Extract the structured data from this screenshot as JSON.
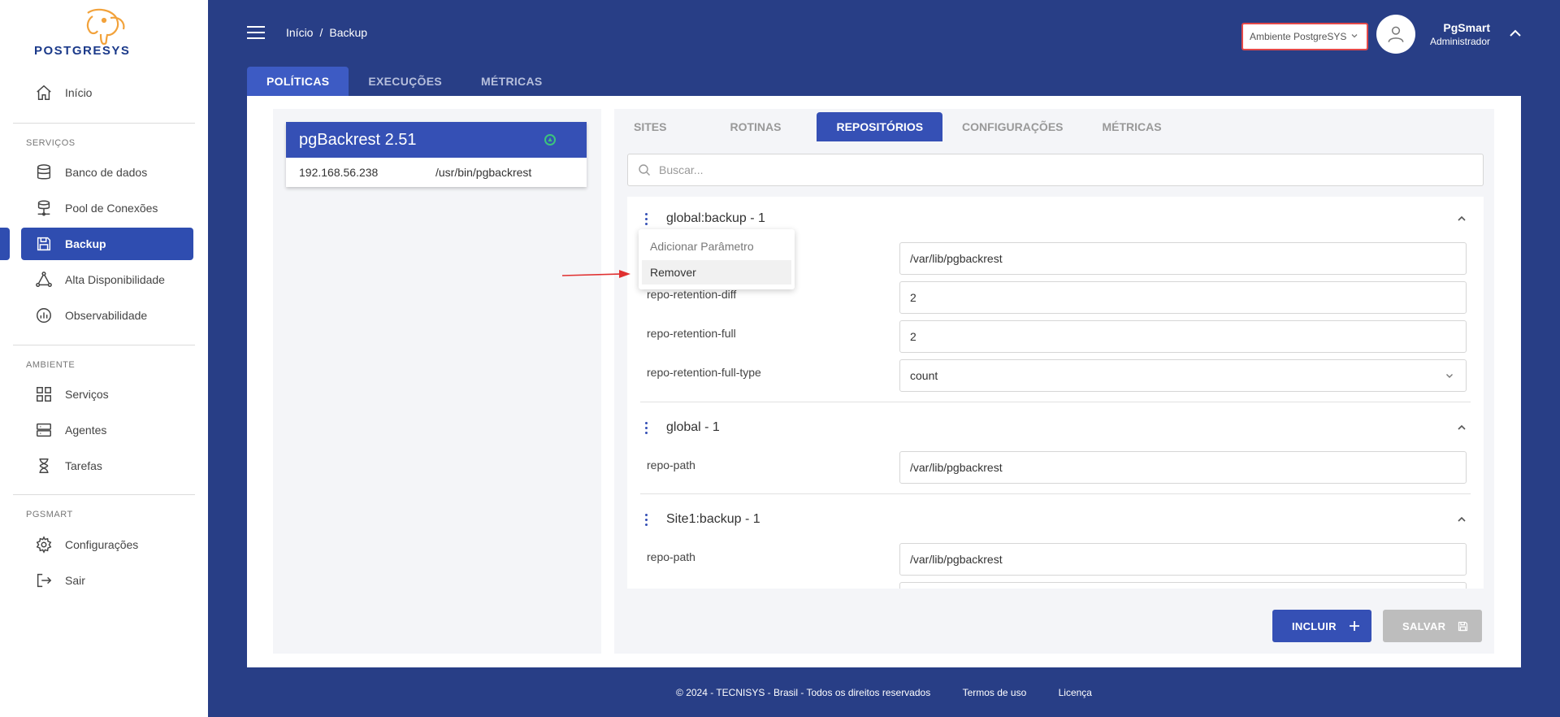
{
  "sidebar": {
    "brand": "POSTGRESYS",
    "home": "Início",
    "sections": [
      {
        "title": "SERVIÇOS",
        "items": [
          "Banco de dados",
          "Pool de Conexões",
          "Backup",
          "Alta Disponibilidade",
          "Observabilidade"
        ]
      },
      {
        "title": "AMBIENTE",
        "items": [
          "Serviços",
          "Agentes",
          "Tarefas"
        ]
      },
      {
        "title": "PGSMART",
        "items": [
          "Configurações",
          "Sair"
        ]
      }
    ]
  },
  "header": {
    "breadcrumb": [
      "Início",
      "Backup"
    ],
    "environment": "Ambiente PostgreSYS",
    "user_name": "PgSmart",
    "user_role": "Administrador"
  },
  "tabs": [
    "POLÍTICAS",
    "EXECUÇÕES",
    "MÉTRICAS"
  ],
  "server_card": {
    "title": "pgBackrest 2.51",
    "ip": "192.168.56.238",
    "path": "/usr/bin/pgbackrest"
  },
  "sub_tabs": [
    "SITES",
    "ROTINAS",
    "REPOSITÓRIOS",
    "CONFIGURAÇÕES",
    "MÉTRICAS"
  ],
  "search": {
    "placeholder": "Buscar..."
  },
  "groups": [
    {
      "title": "global:backup - 1",
      "params": [
        {
          "name": "",
          "value": "/var/lib/pgbackrest"
        },
        {
          "name": "repo-retention-diff",
          "value": "2"
        },
        {
          "name": "repo-retention-full",
          "value": "2"
        },
        {
          "name": "repo-retention-full-type",
          "value": "count"
        }
      ]
    },
    {
      "title": "global - 1",
      "params": [
        {
          "name": "repo-path",
          "value": "/var/lib/pgbackrest"
        }
      ]
    },
    {
      "title": "Site1:backup - 1",
      "params": [
        {
          "name": "repo-path",
          "value": "/var/lib/pgbackrest"
        }
      ]
    }
  ],
  "context_menu": {
    "items": [
      "Adicionar Parâmetro",
      "Remover"
    ]
  },
  "buttons": {
    "include": "INCLUIR",
    "save": "SALVAR"
  },
  "footer": {
    "copyright": "© 2024 - TECNISYS - Brasil - Todos os direitos reservados",
    "terms": "Termos de uso",
    "license": "Licença"
  },
  "colors": {
    "primary": "#283e86",
    "accent": "#3550b5",
    "alert": "#e34949",
    "status_ok": "#3cc47c"
  }
}
